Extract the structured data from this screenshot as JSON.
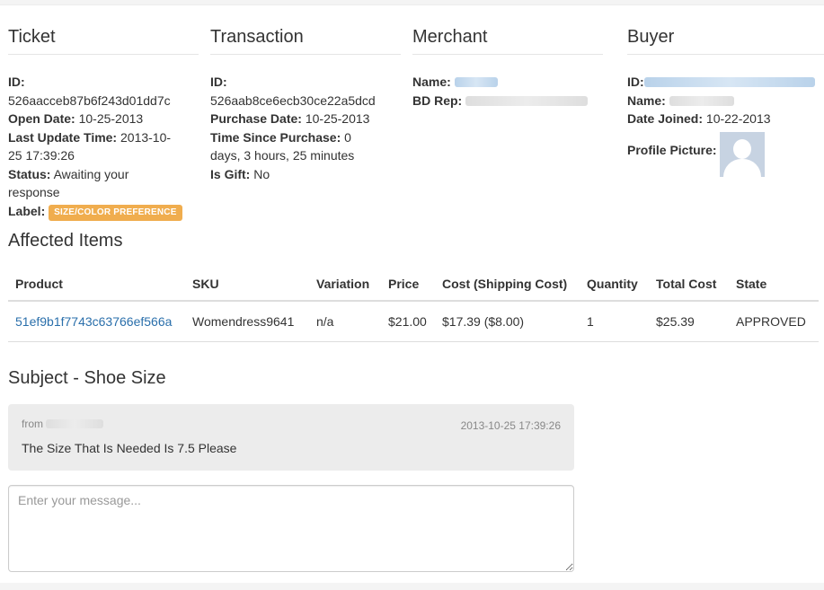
{
  "ticket": {
    "heading": "Ticket",
    "id_label": "ID:",
    "id": "526aacceb87b6f243d01dd7c",
    "open_date_label": "Open Date:",
    "open_date": "10-25-2013",
    "last_update_label": "Last Update Time:",
    "last_update_1": "2013-10-",
    "last_update_2": "25 17:39:26",
    "status_label": "Status:",
    "status_1": "Awaiting your",
    "status_2": "response",
    "label_label": "Label:",
    "label_badge": "SIZE/COLOR PREFERENCE",
    "badge_color": "#f0ad4e"
  },
  "transaction": {
    "heading": "Transaction",
    "id_label": "ID:",
    "id": "526aab8ce6ecb30ce22a5dcd",
    "purchase_date_label": "Purchase Date:",
    "purchase_date": "10-25-2013",
    "time_since_label": "Time Since Purchase:",
    "time_since_1": "0",
    "time_since_2": "days, 3 hours, 25 minutes",
    "is_gift_label": "Is Gift:",
    "is_gift": "No"
  },
  "merchant": {
    "heading": "Merchant",
    "name_label": "Name:",
    "bd_rep_label": "BD Rep:"
  },
  "buyer": {
    "heading": "Buyer",
    "id_label": "ID:",
    "name_label": "Name:",
    "date_joined_label": "Date Joined:",
    "date_joined": "10-22-2013",
    "profile_picture_label": "Profile Picture:",
    "avatar_icon": "default-user-silhouette"
  },
  "affected_items": {
    "heading": "Affected Items",
    "columns": [
      "Product",
      "SKU",
      "Variation",
      "Price",
      "Cost (Shipping Cost)",
      "Quantity",
      "Total Cost",
      "State"
    ],
    "rows": [
      {
        "product": "51ef9b1f7743c63766ef566a",
        "sku": "Womendress9641",
        "variation": "n/a",
        "price": "$21.00",
        "cost": "$17.39 ($8.00)",
        "quantity": "1",
        "total_cost": "$25.39",
        "state": "APPROVED"
      }
    ],
    "link_color": "#2a6fab"
  },
  "subject": {
    "heading": "Subject - Shoe Size"
  },
  "message": {
    "from_label": "from",
    "date": "2013-10-25 17:39:26",
    "body": "The Size That Is Needed Is 7.5 Please"
  },
  "reply": {
    "placeholder": "Enter your message..."
  }
}
